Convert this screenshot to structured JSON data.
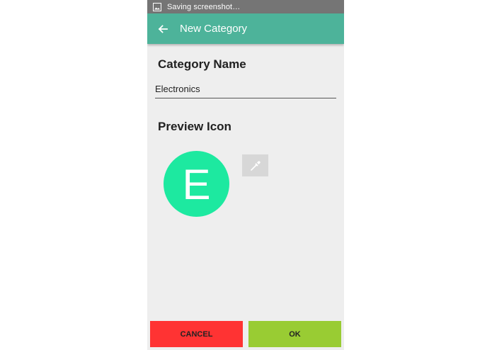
{
  "status_bar": {
    "text": "Saving screenshot…",
    "icon": "image-icon"
  },
  "app_bar": {
    "title": "New Category",
    "back_icon": "arrow-back-icon",
    "color": "#4db39a"
  },
  "form": {
    "name_label": "Category Name",
    "name_value": "Electronics",
    "preview_label": "Preview Icon",
    "preview_letter": "E",
    "preview_color": "#1de9a0",
    "color_picker_icon": "eyedropper-icon"
  },
  "actions": {
    "cancel_label": "CANCEL",
    "ok_label": "OK",
    "cancel_color": "#ff3333",
    "ok_color": "#99cc33"
  }
}
